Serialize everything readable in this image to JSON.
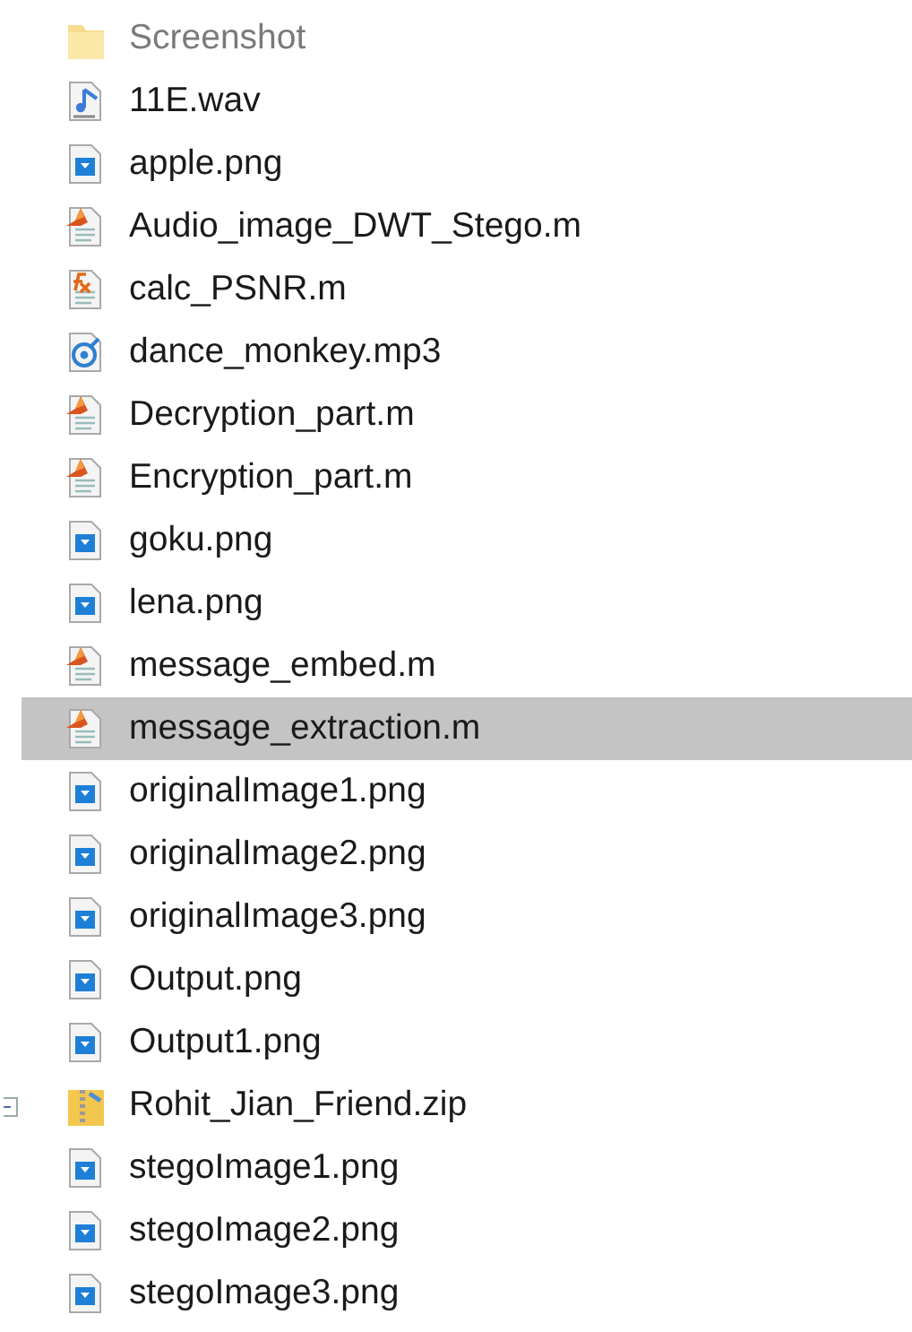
{
  "files": [
    {
      "name": "Screenshot",
      "kind": "folder",
      "dimmed": true,
      "selected": false
    },
    {
      "name": "11E.wav",
      "kind": "audio",
      "dimmed": false,
      "selected": false
    },
    {
      "name": "apple.png",
      "kind": "image",
      "dimmed": false,
      "selected": false
    },
    {
      "name": "Audio_image_DWT_Stego.m",
      "kind": "script",
      "dimmed": false,
      "selected": false
    },
    {
      "name": "calc_PSNR.m",
      "kind": "function",
      "dimmed": false,
      "selected": false
    },
    {
      "name": "dance_monkey.mp3",
      "kind": "media",
      "dimmed": false,
      "selected": false
    },
    {
      "name": "Decryption_part.m",
      "kind": "script",
      "dimmed": false,
      "selected": false
    },
    {
      "name": "Encryption_part.m",
      "kind": "script",
      "dimmed": false,
      "selected": false
    },
    {
      "name": "goku.png",
      "kind": "image",
      "dimmed": false,
      "selected": false
    },
    {
      "name": "lena.png",
      "kind": "image",
      "dimmed": false,
      "selected": false
    },
    {
      "name": "message_embed.m",
      "kind": "script",
      "dimmed": false,
      "selected": false
    },
    {
      "name": "message_extraction.m",
      "kind": "script",
      "dimmed": false,
      "selected": true
    },
    {
      "name": "originalImage1.png",
      "kind": "image",
      "dimmed": false,
      "selected": false
    },
    {
      "name": "originalImage2.png",
      "kind": "image",
      "dimmed": false,
      "selected": false
    },
    {
      "name": "originalImage3.png",
      "kind": "image",
      "dimmed": false,
      "selected": false
    },
    {
      "name": "Output.png",
      "kind": "image",
      "dimmed": false,
      "selected": false
    },
    {
      "name": "Output1.png",
      "kind": "image",
      "dimmed": false,
      "selected": false
    },
    {
      "name": "Rohit_Jian_Friend.zip",
      "kind": "zip",
      "dimmed": false,
      "selected": false
    },
    {
      "name": "stegoImage1.png",
      "kind": "image",
      "dimmed": false,
      "selected": false
    },
    {
      "name": "stegoImage2.png",
      "kind": "image",
      "dimmed": false,
      "selected": false
    },
    {
      "name": "stegoImage3.png",
      "kind": "image",
      "dimmed": false,
      "selected": false
    }
  ]
}
